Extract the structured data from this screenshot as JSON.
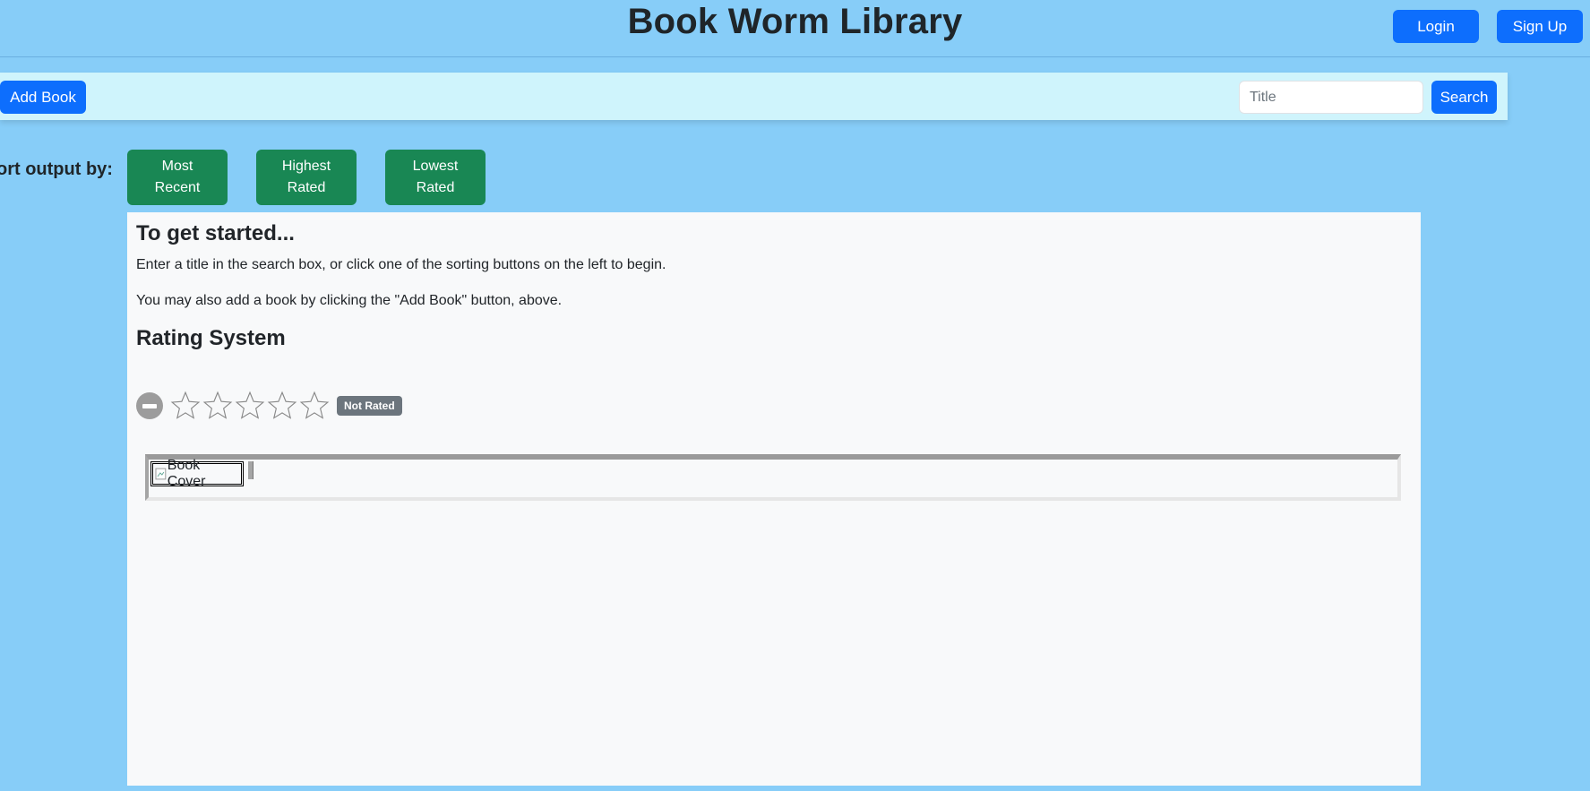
{
  "header": {
    "title": "Book Worm Library",
    "login_label": "Login",
    "signup_label": "Sign Up"
  },
  "toolbar": {
    "add_book_label": "Add Book",
    "search_placeholder": "Title",
    "search_value": "",
    "search_label": "Search"
  },
  "sort": {
    "label": "ort output by:",
    "buttons": [
      {
        "line1": "Most",
        "line2": "Recent"
      },
      {
        "line1": "Highest",
        "line2": "Rated"
      },
      {
        "line1": "Lowest",
        "line2": "Rated"
      }
    ]
  },
  "panel": {
    "heading": "To get started...",
    "text_1": "Enter a title in the search box, or click one of the sorting buttons on the left to begin.",
    "text_2": "You may also add a book by clicking the \"Add Book\" button, above.",
    "rating_heading": "Rating System",
    "rating": {
      "stars_filled": 0,
      "stars_total": 5,
      "badge": "Not Rated",
      "clear_icon": "minus-circle-icon",
      "star_icon": "star-outline-icon"
    },
    "book_cover_alt": "Book Cover"
  },
  "colors": {
    "background": "#87cdf8",
    "primary": "#0d6efd",
    "success": "#198754",
    "toolbar": "#cff4fc",
    "badge": "#6c757d"
  }
}
